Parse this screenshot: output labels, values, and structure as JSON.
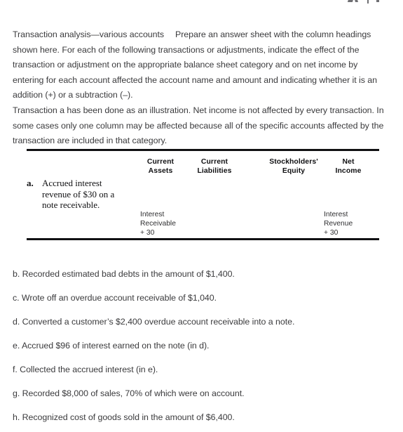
{
  "document": {
    "intro": {
      "lead_in": "Transaction analysis—various accounts",
      "body": "Prepare an answer sheet with the column headings shown here. For each of the following transactions or adjustments, indicate the effect of the transaction or adjustment on the appropriate balance sheet category and on net income by entering for each account affected the account name and amount and indicating whether it is an addition (+) or a subtraction (–)."
    },
    "note": "Transaction a has been done as an illustration. Net income is not affected by every transaction. In some cases only one column may be affected because all of the specific accounts affected by the transaction are included in that category."
  },
  "table": {
    "columns": [
      {
        "line1": "Current",
        "line2": "Assets"
      },
      {
        "line1": "Current",
        "line2": "Liabilities"
      },
      {
        "line1": "Stockholders'",
        "line2": "Equity"
      },
      {
        "line1": "Net",
        "line2": "Income"
      }
    ],
    "row": {
      "marker": "a.",
      "description": [
        "Accrued interest",
        "revenue of $30 on a",
        "note receivable."
      ],
      "current_assets": [
        "Interest",
        "Receivable",
        "+ 30"
      ],
      "net_income": [
        "Interest",
        "Revenue",
        "+ 30"
      ]
    }
  },
  "items": [
    "b. Recorded estimated bad debts in the amount of $1,400.",
    "c. Wrote off an overdue account receivable of $1,040.",
    "d. Converted a customer’s $2,400 overdue account receivable into a note.",
    "e. Accrued $96 of interest earned on the note (in d).",
    "f. Collected the accrued interest (in e).",
    "g. Recorded $8,000 of sales, 70% of which were on account.",
    "h. Recognized cost of goods sold in the amount of $6,400."
  ]
}
